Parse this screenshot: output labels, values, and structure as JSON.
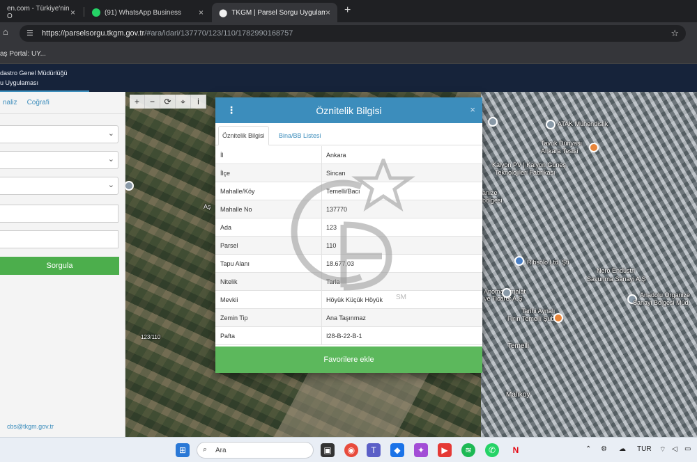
{
  "browser": {
    "tabs": [
      {
        "label": "en.com - Türkiye'nin O",
        "close": "×"
      },
      {
        "label": "(91) WhatsApp Business",
        "close": "×"
      },
      {
        "label": "TKGM | Parsel Sorgu Uygulama",
        "close": "×"
      }
    ],
    "new_tab": "+",
    "url_domain": "https://parselsorgu.tkgm.gov.tr",
    "url_path": "/#ara/idari/137770/123/110/1782990168757",
    "bookmark": "aş Portal: UY..."
  },
  "app_header": {
    "line1": "dastro Genel Müdürlüğü",
    "line2": "u Uygulaması"
  },
  "sidebar": {
    "tabs": [
      "naliz",
      "Coğrafi"
    ],
    "search_button": "Sorgula",
    "email": "cbs@tkgm.gov.tr"
  },
  "map": {
    "tools": [
      "+",
      "−",
      "⟳",
      "⌖",
      "i"
    ],
    "labels": [
      {
        "text": "ATAK Mühendislik"
      },
      {
        "text": "Tavuk Dünyası"
      },
      {
        "text": "Ankara Tesisi"
      },
      {
        "text": "Kalyon PV | Kalyon Güneş"
      },
      {
        "text": "Teknolojileri Fabrikası"
      },
      {
        "text": "anize"
      },
      {
        "text": "bölgesi"
      },
      {
        "text": "Ribsolo Ltd. Şti"
      },
      {
        "text": "Nero Endüstri"
      },
      {
        "text": "Savunma Sanayi A.Ş"
      },
      {
        "text": "Anomak İmalat"
      },
      {
        "text": "ve Ticaret A.Ş"
      },
      {
        "text": "Anadolu Organize"
      },
      {
        "text": "Sanayi Bölgesi Müd."
      },
      {
        "text": "Tarihi Aynalı"
      },
      {
        "text": "Fırın Temelli Şube"
      },
      {
        "text": "Temelli"
      },
      {
        "text": "Malıköy"
      },
      {
        "text": "Aş"
      },
      {
        "text": "123/110"
      }
    ]
  },
  "modal": {
    "menu_icon": "⋮",
    "title": "Öznitelik Bilgisi",
    "close_icon": "×",
    "tabs": [
      "Öznitelik Bilgisi",
      "Bina/BB Listesi"
    ],
    "rows": [
      {
        "key": "İl",
        "value": "Ankara"
      },
      {
        "key": "İlçe",
        "value": "Sincan"
      },
      {
        "key": "Mahalle/Köy",
        "value": "Temelli/Bacı"
      },
      {
        "key": "Mahalle No",
        "value": "137770"
      },
      {
        "key": "Ada",
        "value": "123"
      },
      {
        "key": "Parsel",
        "value": "110"
      },
      {
        "key": "Tapu Alanı",
        "value": "18.677,03"
      },
      {
        "key": "Nitelik",
        "value": "Tarla"
      },
      {
        "key": "Mevkii",
        "value": "Höyük Küçük Höyük"
      },
      {
        "key": "Zemin Tip",
        "value": "Ana Taşınmaz"
      },
      {
        "key": "Pafta",
        "value": "I28-B-22-B-1"
      }
    ],
    "favorite_button": "Favorilere ekle"
  },
  "watermark": {
    "text": "SM"
  },
  "taskbar": {
    "search_placeholder": "Ara",
    "language": "TUR"
  }
}
